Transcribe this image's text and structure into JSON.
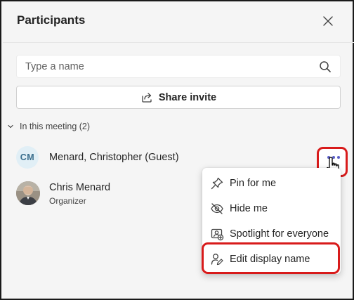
{
  "panel": {
    "title": "Participants",
    "close_label": "Close"
  },
  "search": {
    "placeholder": "Type a name"
  },
  "share": {
    "label": "Share invite"
  },
  "section": {
    "label": "In this meeting (2)",
    "expanded": true
  },
  "participants": [
    {
      "initials": "CM",
      "name": "Menard, Christopher (Guest)",
      "role": ""
    },
    {
      "initials": "",
      "name": "Chris Menard",
      "role": "Organizer"
    }
  ],
  "context_menu": {
    "items": [
      {
        "label": "Pin for me",
        "icon": "pin-icon"
      },
      {
        "label": "Hide me",
        "icon": "eye-off-icon"
      },
      {
        "label": "Spotlight for everyone",
        "icon": "spotlight-icon"
      },
      {
        "label": "Edit display name",
        "icon": "person-edit-icon"
      }
    ]
  },
  "colors": {
    "accent": "#5b5fc7",
    "highlight": "#d81b1b",
    "avatar_bg": "#e1eff6"
  }
}
